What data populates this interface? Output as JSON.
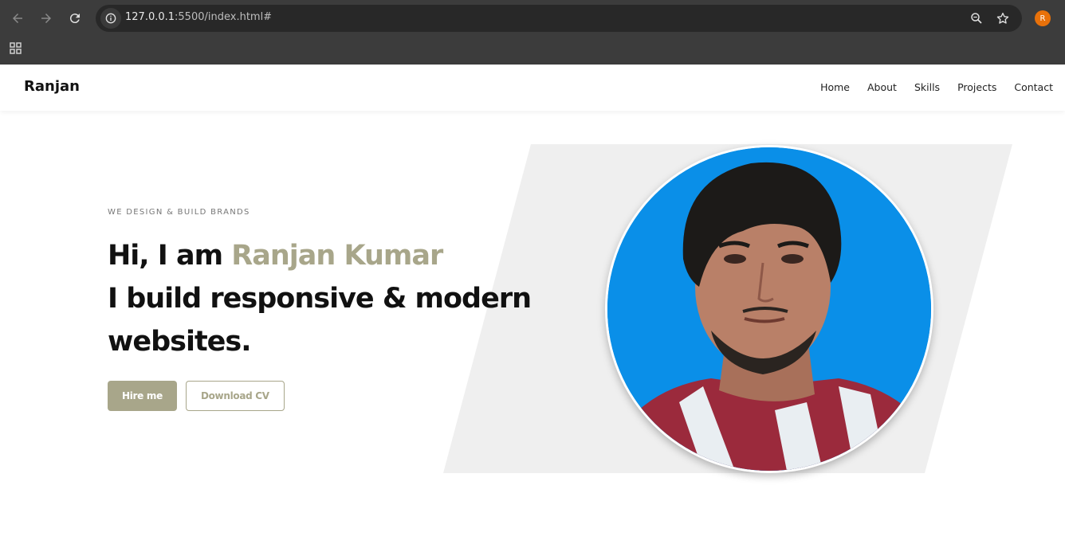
{
  "browser": {
    "url_host": "127.0.0.1",
    "url_path": ":5500/index.html#",
    "profile_initial": "R",
    "profile_color": "#e8710a"
  },
  "site": {
    "logo": "Ranjan",
    "menu": [
      "Home",
      "About",
      "Skills",
      "Projects",
      "Contact"
    ]
  },
  "hero": {
    "tagline": "WE DESIGN & BUILD BRANDS",
    "greeting": "Hi, I am ",
    "name": "Ranjan Kumar",
    "subline": "I build responsive & modern websites.",
    "buttons": {
      "primary": "Hire me",
      "secondary": "Download CV"
    },
    "accent_color": "#a8a68a",
    "photo_bg_color": "#0a8fe8"
  }
}
